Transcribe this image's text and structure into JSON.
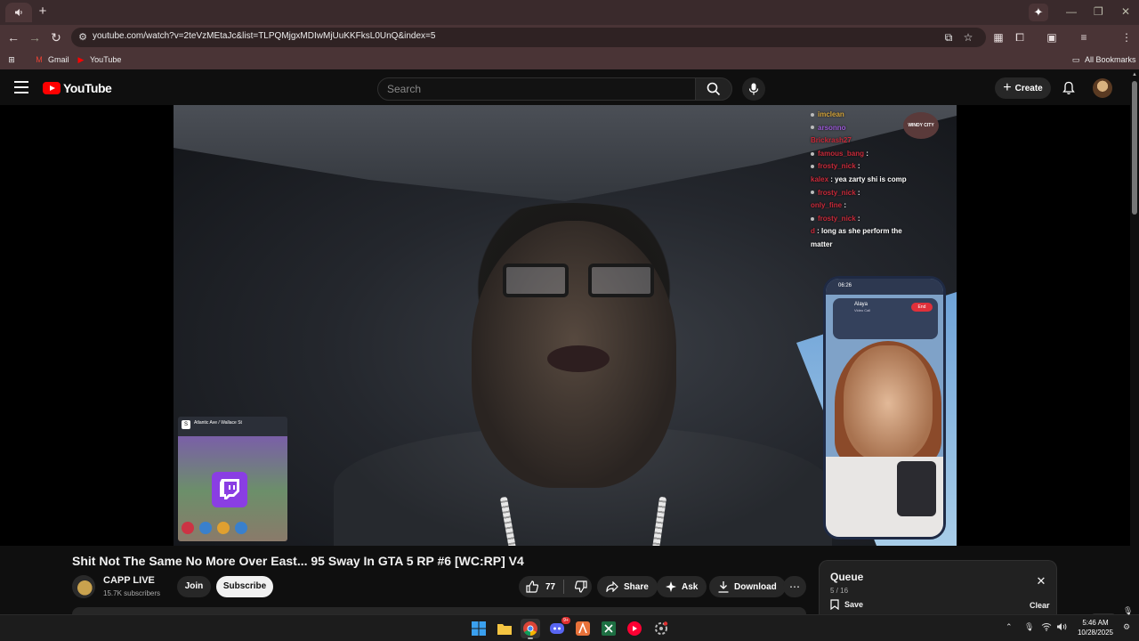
{
  "browser": {
    "url": "youtube.com/watch?v=2teVzMEtaJc&list=TLPQMjgxMDIwMjUuKKFksL0UnQ&index=5",
    "bookmarks": [
      {
        "label": "Gmail",
        "icon": "gmail-icon"
      },
      {
        "label": "YouTube",
        "icon": "youtube-icon"
      }
    ],
    "all_bookmarks": "All Bookmarks"
  },
  "masthead": {
    "logo": "YouTube",
    "search_placeholder": "Search",
    "create_label": "Create"
  },
  "video": {
    "chat": [
      {
        "user": "imclean",
        "msg": "",
        "color": "o"
      },
      {
        "user": "arsonno",
        "msg": "",
        "color": "p"
      },
      {
        "user": "Brickrash27",
        "msg": "",
        "color": "r"
      },
      {
        "user": "famous_bang",
        "msg": ":",
        "color": "r"
      },
      {
        "user": "frosty_nick",
        "msg": ":",
        "color": "r"
      },
      {
        "user": "kalex",
        "msg": ": yea zarty shi is comp",
        "color": "r"
      },
      {
        "user": "frosty_nick",
        "msg": ":",
        "color": "r"
      },
      {
        "user": "only_fine",
        "msg": ":",
        "color": "r"
      },
      {
        "user": "frosty_nick",
        "msg": ":",
        "color": "r"
      },
      {
        "user": "d",
        "msg": ": long as she perform the",
        "color": "r"
      },
      {
        "user": "",
        "msg": "matter",
        "color": "r"
      }
    ],
    "overlay_logo": "WINDY CITY",
    "phone_time": "06:26",
    "phone_caller": "Alaya",
    "phone_call_type": "Video Call",
    "phone_end": "End",
    "map_location": "Atlantic Ave / Wallace St"
  },
  "info": {
    "title": "Shit Not The Same No More Over East... 95 Sway In GTA 5 RP #6 [WC:RP] V4",
    "channel": "CAPP LIVE",
    "subscribers": "15.7K subscribers",
    "join": "Join",
    "subscribe": "Subscribe",
    "likes": "77",
    "share": "Share",
    "ask": "Ask",
    "download": "Download"
  },
  "queue": {
    "title": "Queue",
    "count": "5 / 16",
    "save": "Save",
    "clear": "Clear"
  },
  "taskbar": {
    "time": "5:46 AM",
    "date": "10/28/2025",
    "discord_badge": "9+"
  },
  "colors": {
    "yt_red": "#ff0000",
    "twitch_purple": "#8a3ee3",
    "chrome_frame": "#4a3436"
  }
}
